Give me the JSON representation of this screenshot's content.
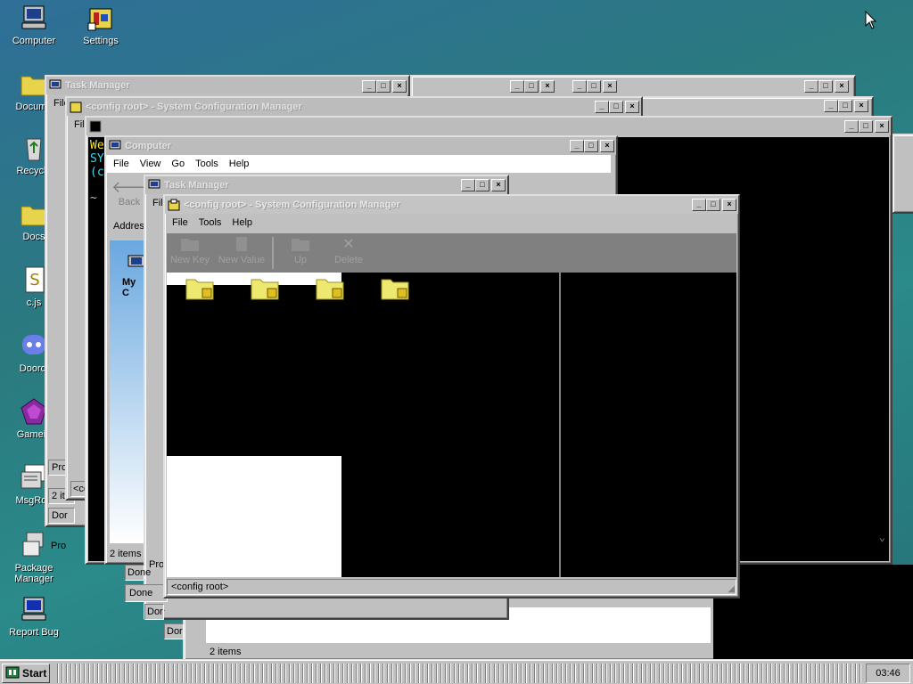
{
  "desktop": {
    "icons": [
      {
        "label": "Computer"
      },
      {
        "label": "Settings"
      },
      {
        "label": "Docume"
      },
      {
        "label": "Recycle"
      },
      {
        "label": "Docs"
      },
      {
        "label": "c.js"
      },
      {
        "label": "Doordi"
      },
      {
        "label": "Gamein"
      },
      {
        "label": "MsgRoo"
      },
      {
        "label": "Package Manager"
      },
      {
        "label": "Report Bug"
      }
    ]
  },
  "windows": {
    "task_manager_back": {
      "title": "Task Manager",
      "menu_file": "File",
      "status1": "Pro",
      "status2": "2 it",
      "status3": "Dor"
    },
    "config_back": {
      "title": "<config root> - System Configuration Manager",
      "menu_file": "File",
      "status": "<co",
      "status2": "Don"
    },
    "terminal": {
      "line1": "We",
      "line2": "SYS",
      "line3": "(c",
      "line4": "~ $"
    },
    "computer": {
      "title": "Computer",
      "menu": [
        "File",
        "View",
        "Go",
        "Tools",
        "Help"
      ],
      "back_label": "Back",
      "address_label": "Addres",
      "panel_label": "My C",
      "status": "2 items",
      "status_done": "Done"
    },
    "task_manager_front": {
      "title": "Task Manager",
      "menu_file": "File",
      "status1": "Pro",
      "status2": "Dor",
      "status3": "Done"
    },
    "config_front": {
      "title": "<config root> - System Configuration Manager",
      "menu": [
        "File",
        "Tools",
        "Help"
      ],
      "toolbar": [
        "New Key",
        "New Value",
        "Up",
        "Delete"
      ],
      "status": "<config root>"
    },
    "bottom_window": {
      "status": "2 items"
    }
  },
  "taskbar": {
    "start_label": "Start",
    "clock": "03:46"
  },
  "colors": {
    "desktop": "#2a7a7f",
    "titlebar_inactive": "#bcbcbc",
    "folder": "#e8e270"
  }
}
